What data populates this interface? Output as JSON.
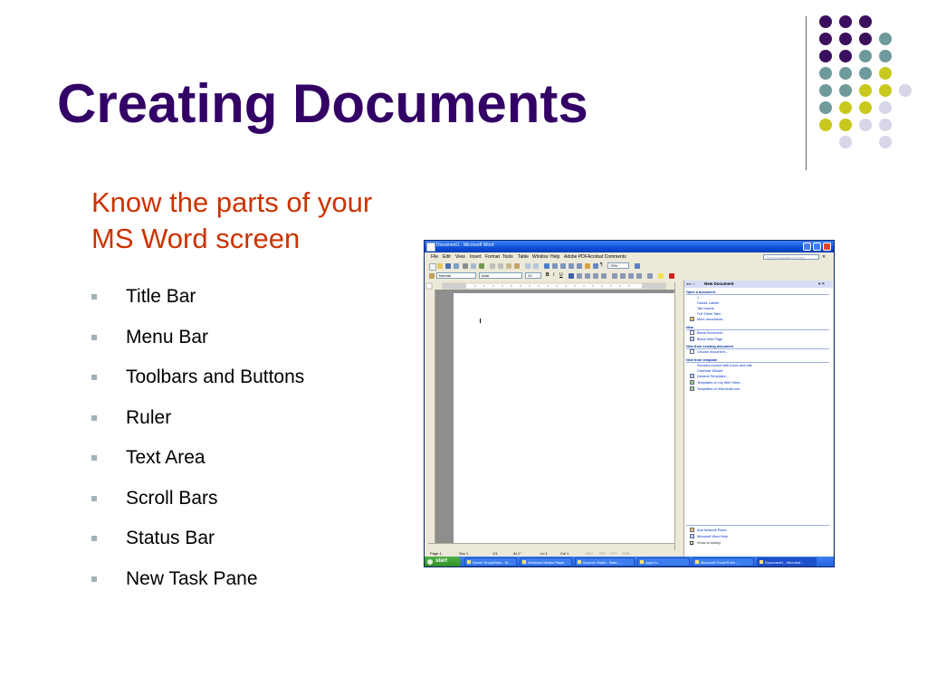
{
  "slide": {
    "title": "Creating Documents",
    "subtitle_line1": "Know the parts of your",
    "subtitle_line2": "MS Word screen",
    "bullets": [
      "Title Bar",
      "Menu Bar",
      "Toolbars and Buttons",
      "Ruler",
      "Text Area",
      "Scroll Bars",
      "Status Bar",
      "New Task Pane"
    ],
    "colors": {
      "title": "#330066",
      "subtitle": "#cc3300",
      "bullet_mark": "#9fb3b8",
      "dot_purple": "#3b0f5e",
      "dot_teal": "#6f9a9c",
      "dot_yellow": "#c8c81e",
      "dot_lavender": "#d6d6e8"
    }
  },
  "screenshot": {
    "window_title": "Document1 - Microsoft Word",
    "menu": [
      "File",
      "Edit",
      "View",
      "Insert",
      "Format",
      "Tools",
      "Table",
      "Window",
      "Help",
      "Adobe PDF",
      "Acrobat Comments"
    ],
    "help_placeholder": "Type a question for help",
    "zoom": "75%",
    "style": "Normal",
    "font": "Arial",
    "font_size": "10",
    "status": {
      "page": "Page 1",
      "sec": "Sec 1",
      "pages": "1/1",
      "at": "At 1\"",
      "ln": "Ln 1",
      "col": "Col 1",
      "rec": "REC",
      "trk": "TRK",
      "ext": "EXT",
      "ovr": "OVR"
    },
    "task_pane": {
      "title": "New Document",
      "open_heading": "Open a document",
      "open_items": [
        "1",
        "Divider Labels",
        "Tab Inserts",
        "Full Sheet Tabs"
      ],
      "more_documents": "More documents...",
      "new_heading": "New",
      "new_items": [
        "Blank Document",
        "Blank Web Page"
      ],
      "existing_heading": "New from existing document",
      "existing_item": "Choose document...",
      "template_heading": "New from template",
      "template_items": [
        "Services invoice with hours and rate",
        "Calendar Wizard"
      ],
      "template_links": [
        "General Templates...",
        "Templates on my Web Sites...",
        "Templates on Microsoft.com"
      ],
      "footer_items": [
        "Add Network Place...",
        "Microsoft Word Help",
        "Show at startup"
      ]
    },
    "taskbar": {
      "start": "start",
      "items": [
        "Novell GroupWise - M...",
        "Windows Media Player",
        "Boomer Radio - Babu ...",
        "Apps to",
        "Microsoft PowerPoint ...",
        "Document1 - Microsof..."
      ]
    }
  }
}
